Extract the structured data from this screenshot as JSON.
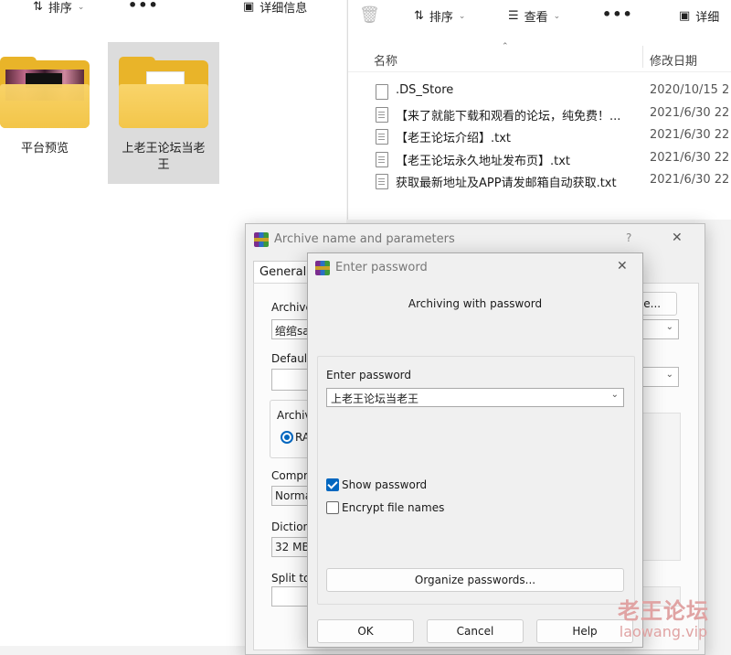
{
  "left_explorer": {
    "toolbar": {
      "sort_label": "排序",
      "more_label": "•••",
      "details_label": "详细信息"
    },
    "folders": [
      {
        "name": "平台预览"
      },
      {
        "name": "上老王论坛当老王"
      }
    ]
  },
  "right_explorer": {
    "toolbar": {
      "sort_label": "排序",
      "view_label": "查看",
      "more_label": "•••",
      "details_label": "详细"
    },
    "columns": {
      "name": "名称",
      "modified": "修改日期"
    },
    "files": [
      {
        "name": ".DS_Store",
        "date": "2020/10/15 2"
      },
      {
        "name": "【来了就能下载和观看的论坛，纯免费！...",
        "date": "2021/6/30 22"
      },
      {
        "name": "【老王论坛介绍】.txt",
        "date": "2021/6/30 22"
      },
      {
        "name": "【老王论坛永久地址发布页】.txt",
        "date": "2021/6/30 22"
      },
      {
        "name": "获取最新地址及APP请发邮箱自动获取.txt",
        "date": "2021/6/30 22"
      }
    ]
  },
  "archive_dialog": {
    "title": "Archive name and parameters",
    "help_glyph": "?",
    "close_glyph": "✕",
    "tab_general": "General",
    "archive_label": "Archive",
    "archive_value": "绾绾sa",
    "browse_label": "se...",
    "default_label": "Default",
    "format_label": "Archiv",
    "format_option": "RA",
    "compression_label": "Compre",
    "compression_value": "Norma",
    "dictionary_label": "Dictiona",
    "dictionary_value": "32 MB",
    "split_label": "Split to"
  },
  "password_dialog": {
    "title": "Enter password",
    "close_glyph": "✕",
    "heading": "Archiving with password",
    "enter_label": "Enter password",
    "password_value": "上老王论坛当老王",
    "show_password_label": "Show password",
    "show_password_checked": true,
    "encrypt_names_label": "Encrypt file names",
    "encrypt_names_checked": false,
    "organize_label": "Organize passwords...",
    "ok_label": "OK",
    "cancel_label": "Cancel",
    "help_label": "Help"
  },
  "watermark": {
    "line1": "老王论坛",
    "line2": "laowang.vip"
  }
}
